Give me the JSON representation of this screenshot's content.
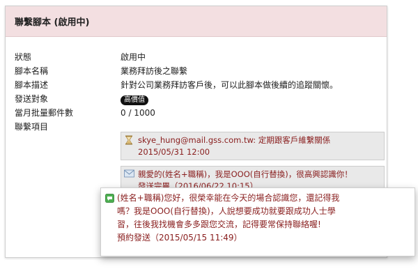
{
  "header": {
    "title": "聯繫腳本 (啟用中)"
  },
  "fields": [
    {
      "label": "狀態",
      "value": "啟用中"
    },
    {
      "label": "腳本名稱",
      "value": "業務拜訪後之聯繫"
    },
    {
      "label": "腳本描述",
      "value": "針對公司業務拜訪客戶後，可以此腳本做後續的追蹤關懷。"
    },
    {
      "label": "發送對象",
      "value": "高價值"
    },
    {
      "label": "當月批量郵件數",
      "value": "0 / 1000"
    },
    {
      "label": "聯繫項目",
      "value": ""
    }
  ],
  "items": [
    {
      "icon": "hourglass-icon",
      "line1": "skye_hung@mail.gss.com.tw: 定期跟客戶維繫關係",
      "line2": "2015/05/31 12:00"
    },
    {
      "icon": "envelope-icon",
      "line1": "親愛的(姓名+職稱)，我是OOO(自行替換)，很高興認識你！",
      "line2": "發送完畢（2016/06/22 10:15）"
    }
  ],
  "popup": {
    "icon": "sms-icon",
    "lines": [
      "(姓名+職稱)您好，很榮幸能在今天的場合認識您，還記得我",
      "嗎？我是OOO(自行替換)，人說想要成功就要跟成功人士學",
      "習，往後我找機會多多跟您交流，記得要常保持聯絡喔!",
      "預約發送（2015/05/15 11:49）"
    ]
  }
}
